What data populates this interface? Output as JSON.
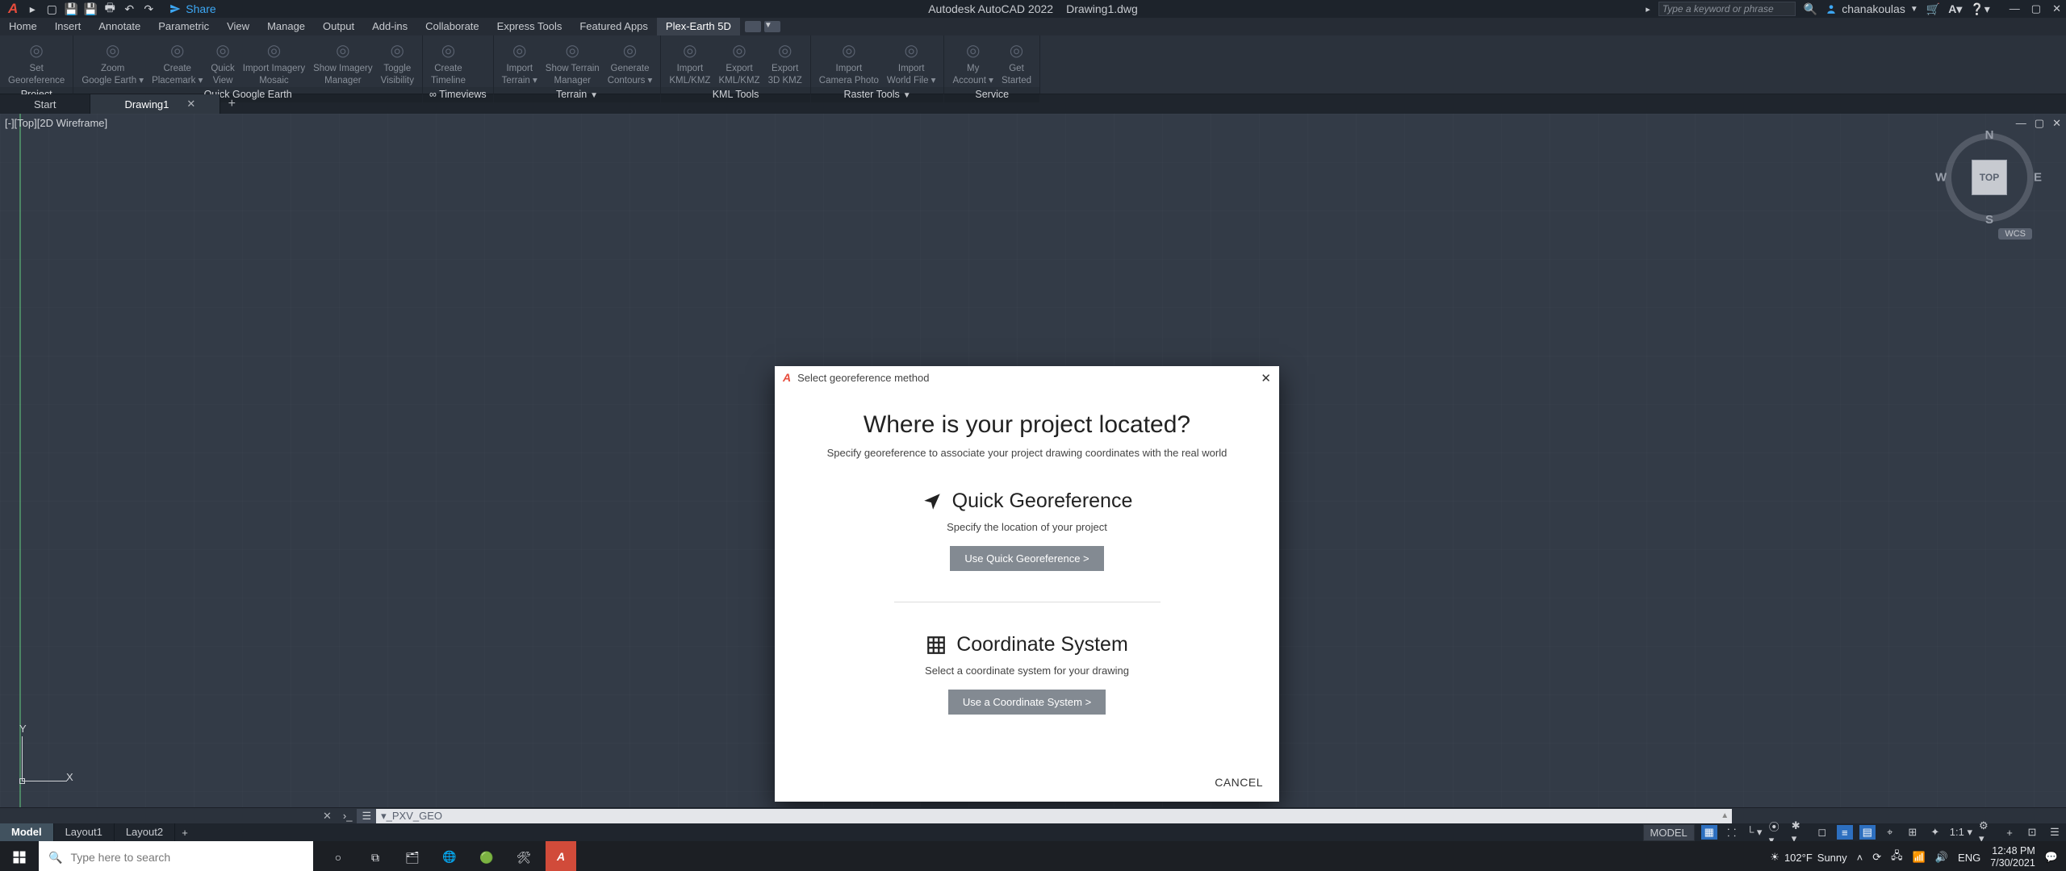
{
  "app": {
    "name": "Autodesk AutoCAD 2022",
    "doc": "Drawing1.dwg"
  },
  "qat": {
    "share": "Share"
  },
  "search": {
    "placeholder": "Type a keyword or phrase"
  },
  "user": {
    "name": "chanakoulas"
  },
  "menu": {
    "items": [
      "Home",
      "Insert",
      "Annotate",
      "Parametric",
      "View",
      "Manage",
      "Output",
      "Add-ins",
      "Collaborate",
      "Express Tools",
      "Featured Apps",
      "Plex-Earth 5D"
    ],
    "active": 11
  },
  "ribbon": {
    "panels": [
      {
        "title": "Project",
        "buttons": [
          {
            "label1": "Set",
            "label2": "Georeference"
          }
        ]
      },
      {
        "title": "Quick Google Earth",
        "buttons": [
          {
            "label1": "Zoom",
            "label2": "Google Earth",
            "dd": true
          },
          {
            "label1": "Create",
            "label2": "Placemark",
            "dd": true
          },
          {
            "label1": "Quick",
            "label2": "View"
          },
          {
            "label1": "Import Imagery",
            "label2": "Mosaic"
          },
          {
            "label1": "Show Imagery",
            "label2": "Manager"
          },
          {
            "label1": "Toggle",
            "label2": "Visibility"
          }
        ]
      },
      {
        "title": "∞ Timeviews",
        "buttons": [
          {
            "label1": "Create",
            "label2": "Timeline"
          }
        ]
      },
      {
        "title": "Terrain",
        "dd": true,
        "buttons": [
          {
            "label1": "Import",
            "label2": "Terrain",
            "dd": true
          },
          {
            "label1": "Show Terrain",
            "label2": "Manager"
          },
          {
            "label1": "Generate",
            "label2": "Contours",
            "dd": true
          }
        ]
      },
      {
        "title": "KML Tools",
        "buttons": [
          {
            "label1": "Import",
            "label2": "KML/KMZ"
          },
          {
            "label1": "Export",
            "label2": "KML/KMZ"
          },
          {
            "label1": "Export",
            "label2": "3D KMZ"
          }
        ]
      },
      {
        "title": "Raster Tools",
        "dd": true,
        "buttons": [
          {
            "label1": "Import",
            "label2": "Camera Photo"
          },
          {
            "label1": "Import",
            "label2": "World File",
            "dd": true
          }
        ]
      },
      {
        "title": "Service",
        "buttons": [
          {
            "label1": "My",
            "label2": "Account",
            "dd": true
          },
          {
            "label1": "Get",
            "label2": "Started"
          }
        ]
      }
    ]
  },
  "file_tabs": {
    "start": "Start",
    "active": "Drawing1"
  },
  "viewport": {
    "label": "[-][Top][2D Wireframe]"
  },
  "viewcube": {
    "face": "TOP",
    "n": "N",
    "s": "S",
    "e": "E",
    "w": "W",
    "wcs": "WCS"
  },
  "ucs": {
    "x": "X",
    "y": "Y"
  },
  "cmd": {
    "prefix": "▾_PXV_GEO"
  },
  "model_tabs": {
    "items": [
      "Model",
      "Layout1",
      "Layout2"
    ],
    "active": 0
  },
  "status": {
    "model": "MODEL",
    "scale": "1:1"
  },
  "dialog": {
    "title": "Select georeference method",
    "heading": "Where is your project located?",
    "sub": "Specify georeference to associate your project drawing coordinates with the real world",
    "quick_title": "Quick Georeference",
    "quick_desc": "Specify the location of your project",
    "quick_btn": "Use Quick Georeference >",
    "cs_title": "Coordinate System",
    "cs_desc": "Select a coordinate system for your drawing",
    "cs_btn": "Use a Coordinate System >",
    "cancel": "CANCEL"
  },
  "taskbar": {
    "search_placeholder": "Type here to search",
    "weather_temp": "102°F",
    "weather_text": "Sunny",
    "lang": "ENG",
    "time": "12:48 PM",
    "date": "7/30/2021"
  }
}
